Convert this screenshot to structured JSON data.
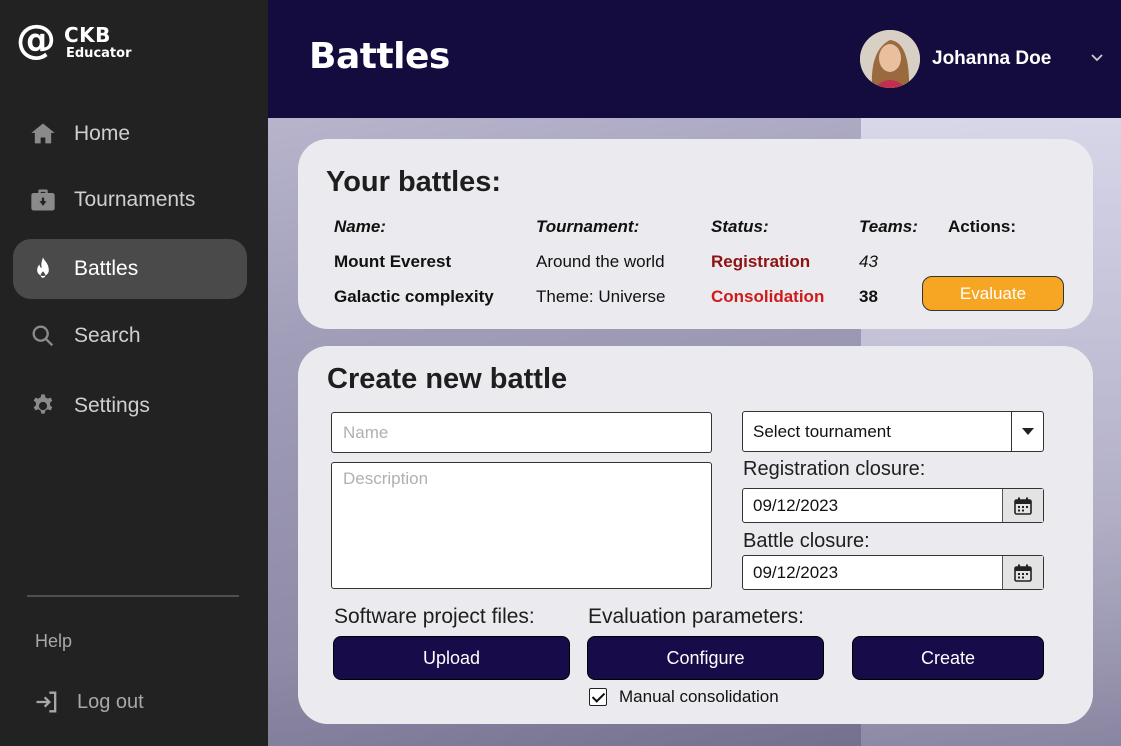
{
  "app": {
    "title": "CKB",
    "subtitle": "Educator",
    "logo_icon": "at-sign-icon"
  },
  "sidebar": {
    "items": [
      {
        "label": "Home",
        "icon": "home-icon",
        "active": false
      },
      {
        "label": "Tournaments",
        "icon": "briefcase-icon",
        "active": false
      },
      {
        "label": "Battles",
        "icon": "flame-icon",
        "active": true
      },
      {
        "label": "Search",
        "icon": "search-icon",
        "active": false
      },
      {
        "label": "Settings",
        "icon": "gear-icon",
        "active": false
      }
    ],
    "help": "Help",
    "logout": "Log out"
  },
  "header": {
    "title": "Battles",
    "user_name": "Johanna Doe"
  },
  "battles": {
    "title": "Your battles:",
    "columns": [
      "Name:",
      "Tournament:",
      "Status:",
      "Teams:",
      "Actions:"
    ],
    "rows": [
      {
        "name": "Mount Everest",
        "tournament": "Around the world",
        "status": "Registration",
        "teams": "43",
        "action": ""
      },
      {
        "name": "Galactic complexity",
        "tournament": "Theme: Universe",
        "status": "Consolidation",
        "teams": "38",
        "action": "Evaluate"
      }
    ]
  },
  "create": {
    "title": "Create new battle",
    "name_placeholder": "Name",
    "description_placeholder": "Description",
    "tournament_select": "Select tournament",
    "registration_label": "Registration closure:",
    "registration_date": "09/12/2023",
    "battle_label": "Battle closure:",
    "battle_date": "09/12/2023",
    "files_label": "Software project files:",
    "eval_label": "Evaluation parameters:",
    "upload": "Upload",
    "configure": "Configure",
    "create": "Create",
    "manual_consolidation": "Manual consolidation",
    "manual_consolidation_checked": true
  },
  "colors": {
    "header": "#140c3e",
    "sidebar": "#222222",
    "accent_orange": "#f7a623",
    "button_navy": "#170c49",
    "status_registration": "#8e1212",
    "status_consolidation": "#d01a1a"
  }
}
